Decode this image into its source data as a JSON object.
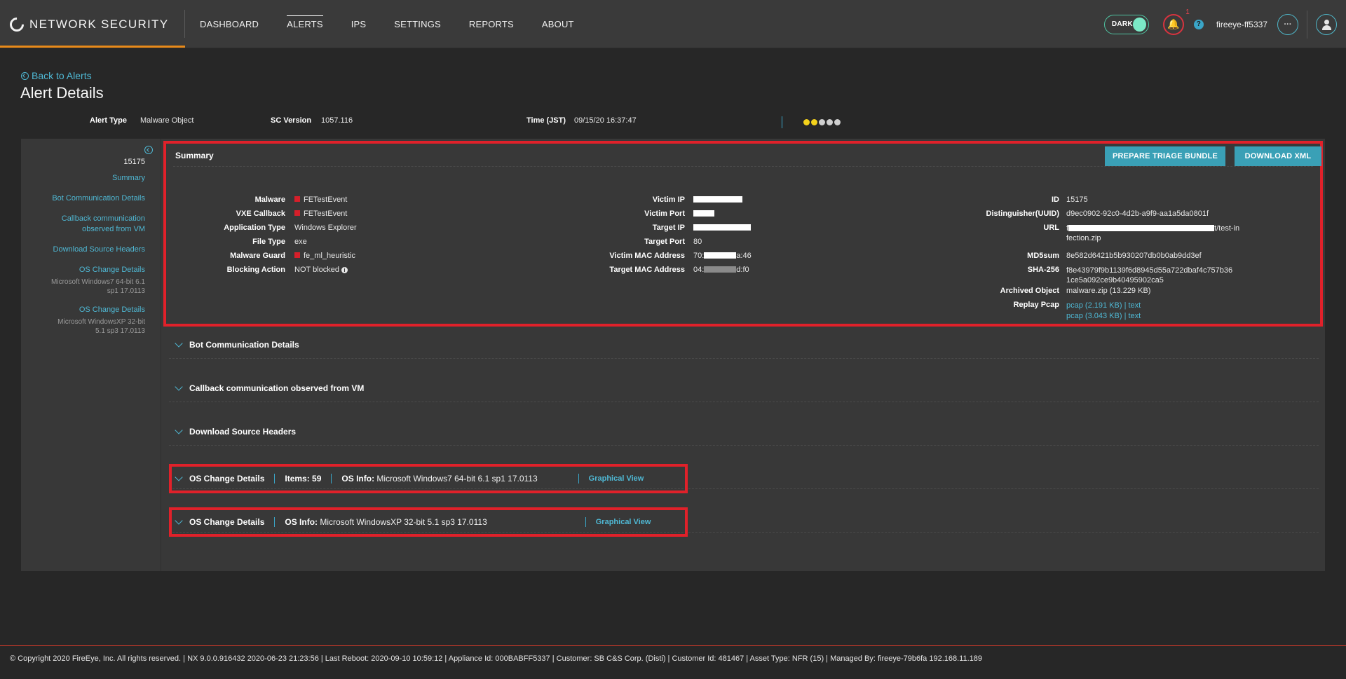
{
  "brand": {
    "name": "NETWORK SECURITY"
  },
  "nav": {
    "items": [
      {
        "label": "DASHBOARD"
      },
      {
        "label": "ALERTS"
      },
      {
        "label": "IPS"
      },
      {
        "label": "SETTINGS"
      },
      {
        "label": "REPORTS"
      },
      {
        "label": "ABOUT"
      }
    ],
    "active": "ALERTS"
  },
  "tools": {
    "dark_label": "DARK",
    "notification_count": "1",
    "help": "?",
    "username": "fireeye-ff5337",
    "more": "···"
  },
  "page": {
    "back_label": "Back to Alerts",
    "title": "Alert Details"
  },
  "meta": {
    "alert_type_label": "Alert Type",
    "alert_type_value": "Malware Object",
    "sc_version_label": "SC Version",
    "sc_version_value": "1057.116",
    "time_label": "Time (JST)",
    "time_value": "09/15/20 16:37:47",
    "severity_dots": [
      "#f3d21b",
      "#f3d21b",
      "#cfcfcf",
      "#cfcfcf",
      "#cfcfcf"
    ]
  },
  "sidebar": {
    "id": "15175",
    "links": [
      {
        "label": "Summary"
      },
      {
        "label": "Bot Communication Details"
      },
      {
        "label": "Callback communication observed from VM"
      },
      {
        "label": "Download Source Headers"
      },
      {
        "label": "OS Change Details",
        "sub": "Microsoft Windows7 64-bit 6.1 sp1 17.0113"
      },
      {
        "label": "OS Change Details",
        "sub": "Microsoft WindowsXP 32-bit 5.1 sp3 17.0113"
      }
    ]
  },
  "summary": {
    "title": "Summary",
    "prepare_btn": "PREPARE TRIAGE BUNDLE",
    "download_btn": "DOWNLOAD XML",
    "col1": [
      {
        "k": "Malware",
        "v": "FETestEvent"
      },
      {
        "k": "VXE Callback",
        "v": "FETestEvent"
      },
      {
        "k": "Application Type",
        "v": "Windows Explorer"
      },
      {
        "k": "File Type",
        "v": "exe"
      },
      {
        "k": "Malware Guard",
        "v": "fe_ml_heuristic"
      },
      {
        "k": "Blocking Action",
        "v": "NOT blocked"
      }
    ],
    "col2": [
      {
        "k": "Victim IP",
        "v": ""
      },
      {
        "k": "Victim Port",
        "v": ""
      },
      {
        "k": "Target IP",
        "v": ""
      },
      {
        "k": "Target Port",
        "v": "80"
      },
      {
        "k": "Victim MAC Address",
        "v_pre": "70:",
        "v_post": "a:46"
      },
      {
        "k": "Target MAC Address",
        "v_pre": "04:",
        "v_post": "d:f0"
      }
    ],
    "col3": {
      "id_label": "ID",
      "id": "15175",
      "uuid_label": "Distinguisher(UUID)",
      "uuid": "d9ec0902-92c0-4d2b-a9f9-aa1a5da0801f",
      "url_label": "URL",
      "url_pre": "f",
      "url_post": "t/test-in",
      "url_line2": "fection.zip",
      "md5_label": "MD5sum",
      "md5": "8e582d6421b5b930207db0b0ab9dd3ef",
      "sha_label": "SHA-256",
      "sha_line1": "f8e43979f9b1139f6d8945d55a722dbaf4c757b36",
      "sha_line2": "1ce5a092ce9b40495902ca5",
      "archived_label": "Archived Object",
      "archived": "malware.zip (13.229 KB)",
      "pcap_label": "Replay Pcap",
      "pcap1": "pcap (2.191 KB)",
      "pcap1_text": "text",
      "pcap2": "pcap (3.043 KB)",
      "pcap2_text": "text",
      "sep": "|"
    }
  },
  "sections": [
    {
      "title": "Bot Communication Details"
    },
    {
      "title": "Callback communication observed from VM"
    },
    {
      "title": "Download Source Headers"
    }
  ],
  "os_changes": [
    {
      "title": "OS Change Details",
      "items_label": "Items: 59",
      "info_label": "OS Info:",
      "info": "Microsoft Windows7 64-bit 6.1 sp1 17.0113",
      "graph": "Graphical View"
    },
    {
      "title": "OS Change Details",
      "info_label": "OS Info:",
      "info": "Microsoft WindowsXP 32-bit 5.1 sp3 17.0113",
      "graph": "Graphical View"
    }
  ],
  "footer": {
    "text": "© Copyright 2020 FireEye, Inc. All rights reserved.  |  NX 9.0.0.916432 2020-06-23 21:23:56  |  Last Reboot: 2020-09-10 10:59:12  |  Appliance Id: 000BABFF5337  |  Customer: SB C&S Corp. (Disti)  |  Customer Id: 481467  |  Asset Type: NFR (15)  |  Managed By: fireeye-79b6fa 192.168.11.189"
  }
}
